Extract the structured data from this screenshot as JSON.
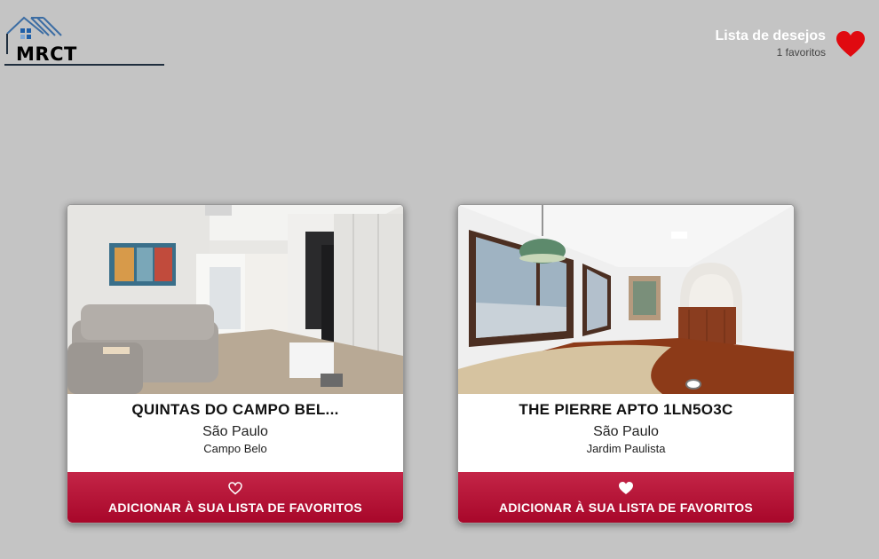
{
  "header": {
    "logo_text": "MRCT",
    "wishlist": {
      "title": "Lista de desejos",
      "count_label": "1 favoritos"
    }
  },
  "listings": [
    {
      "name": "QUINTAS DO CAMPO BEL...",
      "city": "São Paulo",
      "neighborhood": "Campo Belo",
      "button_label": "ADICIONAR À SUA LISTA DE FAVORITOS",
      "favorited": false
    },
    {
      "name": "THE PIERRE APTO 1LN5O3C",
      "city": "São Paulo",
      "neighborhood": "Jardim Paulista",
      "button_label": "ADICIONAR À SUA LISTA DE FAVORITOS",
      "favorited": true
    }
  ],
  "colors": {
    "background": "#c4c4c4",
    "accent": "#b5123a",
    "heart": "#e00a10"
  },
  "icons": {
    "wishlist": "heart-icon",
    "unfavorited": "heart-outline-icon",
    "favorited": "heart-filled-icon"
  }
}
